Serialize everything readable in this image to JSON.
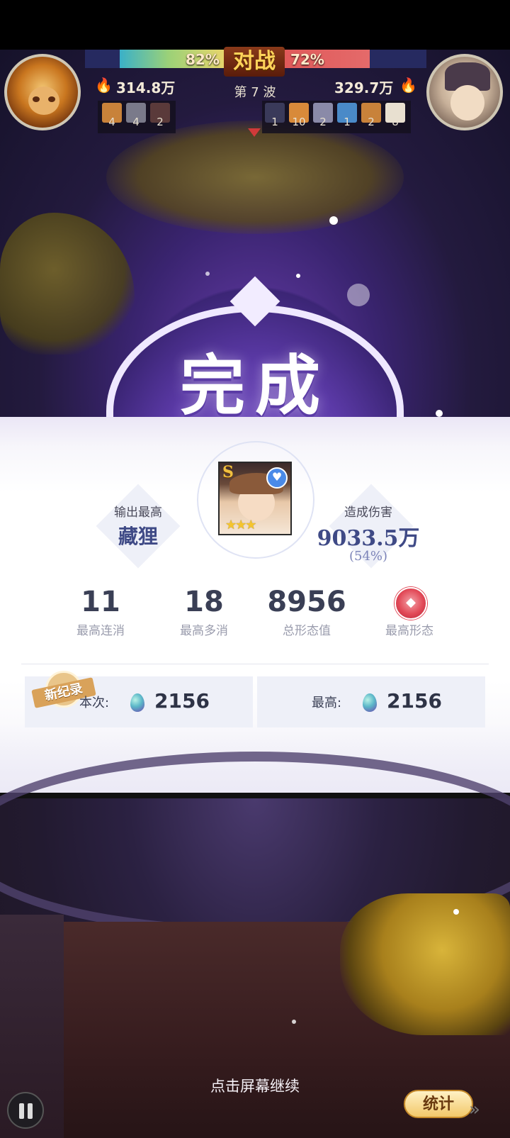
{
  "hud": {
    "left_percent": "82%",
    "right_percent": "72%",
    "vs_label": "对战",
    "wave_label": "第 7 波",
    "left_power": "314.8万",
    "right_power": "329.7万",
    "left_units": [
      "4",
      "4",
      "2"
    ],
    "right_units": [
      "1",
      "10",
      "2",
      "1",
      "2",
      "8"
    ],
    "left_hp_fraction": 0.82,
    "right_hp_fraction": 0.72
  },
  "banner": {
    "title": "完成"
  },
  "result": {
    "top_output_label": "输出最高",
    "top_output_name": "藏狸",
    "damage_label": "造成伤害",
    "damage_value": "9033.5万",
    "damage_percent": "(54%)",
    "hero_rank": "S",
    "hero_stars": "★★★",
    "stats": [
      {
        "value": "11",
        "label": "最高连消"
      },
      {
        "value": "18",
        "label": "最高多消"
      },
      {
        "value": "8956",
        "label": "总形态值"
      },
      {
        "value": "",
        "label": "最高形态"
      }
    ],
    "new_record_label": "新纪录",
    "current_label": "本次:",
    "current_value": "2156",
    "best_label": "最高:",
    "best_value": "2156"
  },
  "footer": {
    "tap_hint": "点击屏幕继续",
    "stats_button": "统计"
  },
  "icons": {
    "pause": "pause-icon",
    "skip": "fast-forward-icon",
    "egg": "egg-icon",
    "mask": "mask-icon",
    "heart": "heart-icon",
    "flame": "flame-icon"
  },
  "colors": {
    "accent_purple": "#5c3aa8",
    "text_blue": "#3f4a86",
    "stat_text": "#3a3f55",
    "gold": "#f2c86a"
  }
}
